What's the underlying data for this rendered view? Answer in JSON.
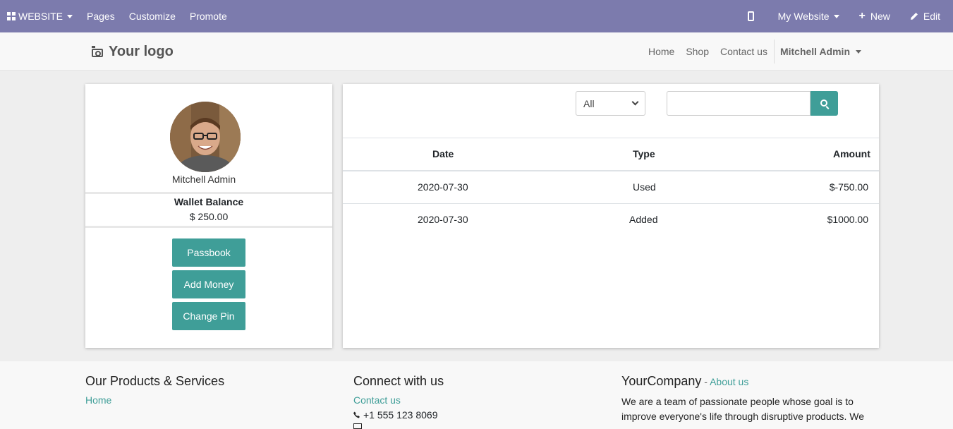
{
  "adminbar": {
    "website_label": "WEBSITE",
    "pages_label": "Pages",
    "customize_label": "Customize",
    "promote_label": "Promote",
    "mywebsite_label": "My Website",
    "new_label": "New",
    "edit_label": "Edit"
  },
  "header": {
    "logo_text": "Your logo",
    "nav": [
      "Home",
      "Shop",
      "Contact us"
    ],
    "user": "Mitchell Admin"
  },
  "profile": {
    "name": "Mitchell Admin",
    "wallet_title": "Wallet Balance",
    "wallet_amount": "$ 250.00",
    "buttons": [
      "Passbook",
      "Add Money",
      "Change Pin"
    ]
  },
  "transactions": {
    "filter_selected": "All",
    "search_value": "",
    "columns": [
      "Date",
      "Type",
      "Amount"
    ],
    "rows": [
      {
        "date": "2020-07-30",
        "type": "Used",
        "amount": "$-750.00"
      },
      {
        "date": "2020-07-30",
        "type": "Added",
        "amount": "$1000.00"
      }
    ]
  },
  "footer": {
    "products_title": "Our Products & Services",
    "products_link": "Home",
    "connect_title": "Connect with us",
    "contact_link": "Contact us",
    "phone": "+1 555 123 8069",
    "company_title": "YourCompany",
    "about_sep": " - ",
    "about_link": "About us",
    "company_text": "We are a team of passionate people whose goal is to improve everyone's life through disruptive products. We"
  },
  "colors": {
    "adminbar": "#7c7bad",
    "accent": "#3f9e98"
  }
}
